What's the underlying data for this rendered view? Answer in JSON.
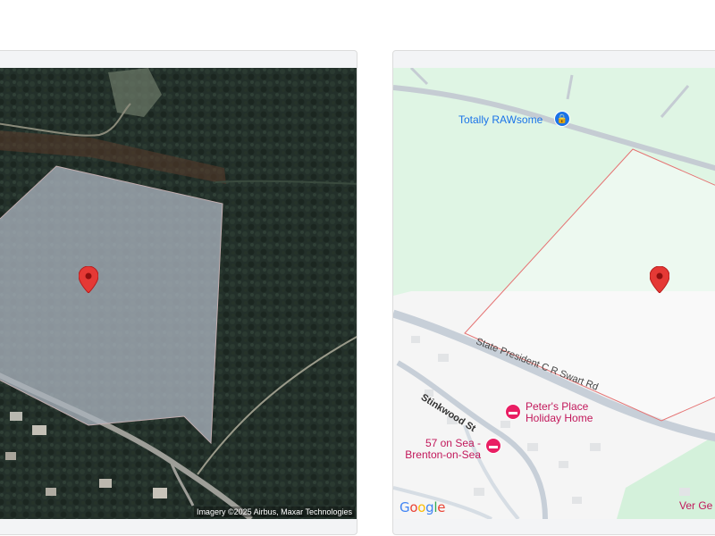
{
  "satellite": {
    "attribution": "Imagery ©2025 Airbus, Maxar Technologies"
  },
  "roadmap": {
    "logo": "Google",
    "pois": {
      "totally_rawsome": "Totally RAWsome",
      "peters_place_line1": "Peter's Place",
      "peters_place_line2": "Holiday Home",
      "sea_line1": "57 on Sea -",
      "sea_line2": "Brenton-on-Sea",
      "ver_ge": "Ver Ge"
    },
    "roads": {
      "state_president": "State President C R Swart Rd",
      "stinkwood": "Stinkwood St"
    }
  },
  "colors": {
    "pin": "#e53935",
    "poi_blue": "#1a73e8",
    "poi_pink": "#e91e63",
    "parcel_outline": "#e57373"
  }
}
